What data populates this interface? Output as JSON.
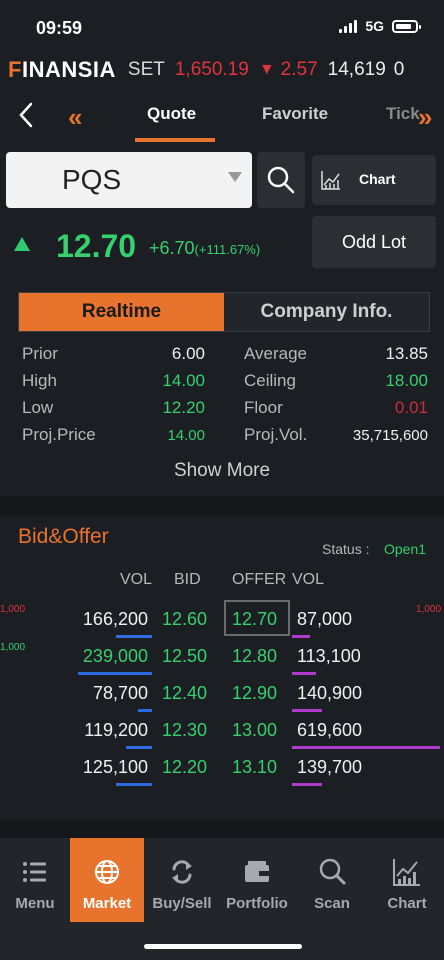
{
  "status_bar": {
    "time": "09:59",
    "network": "5G"
  },
  "ticker": {
    "logo_mark": "F",
    "logo_rest": "INANSIA",
    "index": "SET",
    "index_value": "1,650.19",
    "index_change": "2.57",
    "volume": "14,619",
    "more": "0"
  },
  "nav": {
    "tabs": [
      {
        "label": "Quote"
      },
      {
        "label": "Favorite"
      },
      {
        "label": "Tick"
      }
    ]
  },
  "quote": {
    "symbol": "PQS",
    "chart_label": "Chart",
    "odd_lot_label": "Odd Lot",
    "price": "12.70",
    "change": "+6.70",
    "change_pct": "(+111.67%)"
  },
  "info_tabs": {
    "realtime": "Realtime",
    "company": "Company Info."
  },
  "stats": {
    "rows": [
      {
        "l1": "Prior",
        "v1": "6.00",
        "l2": "Average",
        "v2": "13.85"
      },
      {
        "l1": "High",
        "v1": "14.00",
        "l2": "Ceiling",
        "v2": "18.00"
      },
      {
        "l1": "Low",
        "v1": "12.20",
        "l2": "Floor",
        "v2": "0.01"
      },
      {
        "l1": "Proj.Price",
        "v1": "14.00",
        "l2": "Proj.Vol.",
        "v2": "35,715,600"
      }
    ],
    "show_more": "Show More"
  },
  "bid_offer": {
    "title": "Bid&Offer",
    "status_label": "Status :",
    "status_value": "Open1",
    "headers": {
      "bid_vol": "VOL",
      "bid": "BID",
      "offer": "OFFER",
      "offer_vol": "VOL"
    },
    "side_labels": {
      "left_1": "1,000",
      "left_2": "1,000",
      "right_1": "1,000"
    },
    "rows": [
      {
        "bid_vol": "166,200",
        "bid": "12.60",
        "offer": "12.70",
        "offer_vol": "87,000"
      },
      {
        "bid_vol": "239,000",
        "bid": "12.50",
        "offer": "12.80",
        "offer_vol": "113,100"
      },
      {
        "bid_vol": "78,700",
        "bid": "12.40",
        "offer": "12.90",
        "offer_vol": "140,900"
      },
      {
        "bid_vol": "119,200",
        "bid": "12.30",
        "offer": "13.00",
        "offer_vol": "619,600"
      },
      {
        "bid_vol": "125,100",
        "bid": "12.20",
        "offer": "13.10",
        "offer_vol": "139,700"
      }
    ]
  },
  "tabbar": {
    "items": [
      {
        "label": "Menu",
        "icon": "menu-icon"
      },
      {
        "label": "Market",
        "icon": "market-globe-icon"
      },
      {
        "label": "Buy/Sell",
        "icon": "buy-sell-icon"
      },
      {
        "label": "Portfolio",
        "icon": "portfolio-wallet-icon"
      },
      {
        "label": "Scan",
        "icon": "scan-search-icon"
      },
      {
        "label": "Chart",
        "icon": "chart-icon"
      }
    ]
  },
  "colors": {
    "accent": "#e8732c",
    "up": "#36d06e",
    "down": "#e0343e",
    "bid_bar": "#2d6cdf",
    "offer_bar": "#b03acb"
  }
}
